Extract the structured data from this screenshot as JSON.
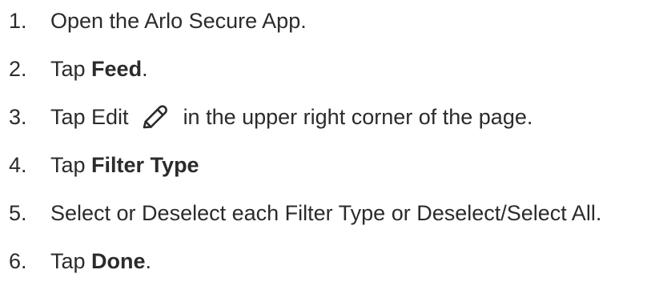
{
  "steps": [
    {
      "number": "1.",
      "parts": [
        "Open the Arlo Secure App."
      ]
    },
    {
      "number": "2.",
      "parts": [
        "Tap ",
        "Feed",
        "."
      ]
    },
    {
      "number": "3.",
      "parts": [
        "Tap Edit",
        "in the upper right corner of the page."
      ],
      "icon": "pencil-icon"
    },
    {
      "number": "4.",
      "parts": [
        "Tap ",
        "Filter Type"
      ]
    },
    {
      "number": "5.",
      "parts": [
        "Select or Deselect each Filter Type or Deselect/Select All."
      ]
    },
    {
      "number": "6.",
      "parts": [
        "Tap ",
        "Done",
        "."
      ]
    }
  ]
}
